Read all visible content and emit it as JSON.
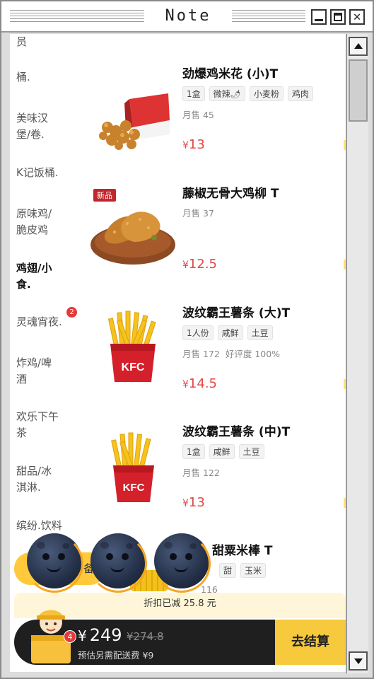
{
  "window": {
    "title": "Note"
  },
  "categories": [
    {
      "label": "员"
    },
    {
      "label": "桶."
    },
    {
      "label": "美味汉堡/卷."
    },
    {
      "label": "K记饭桶."
    },
    {
      "label": "原味鸡/脆皮鸡"
    },
    {
      "label": "鸡翅/小食."
    },
    {
      "label": "灵魂宵夜.",
      "badge": "2"
    },
    {
      "label": "炸鸡/啤酒"
    },
    {
      "label": "欢乐下午茶"
    },
    {
      "label": "甜品/冰淇淋."
    },
    {
      "label": "缤纷.饮料"
    }
  ],
  "products": [
    {
      "name": "劲爆鸡米花 (小)T",
      "tags": [
        "1盒",
        "微辣🌶",
        "小麦粉",
        "鸡肉"
      ],
      "sales": "月售 45",
      "rating": "",
      "price": "13"
    },
    {
      "name": "藤椒无骨大鸡柳 T",
      "tags": [],
      "sales": "月售 37",
      "rating": "",
      "price": "12.5",
      "new_label": "新品"
    },
    {
      "name": "波纹霸王薯条 (大)T",
      "tags": [
        "1人份",
        "咸鲜",
        "土豆"
      ],
      "sales": "月售 172",
      "rating": "好评度 100%",
      "price": "14.5"
    },
    {
      "name": "波纹霸王薯条 (中)T",
      "tags": [
        "1盒",
        "咸鲜",
        "土豆"
      ],
      "sales": "月售 122",
      "rating": "",
      "price": "13"
    }
  ],
  "peek": {
    "title": "甜粟米棒 T",
    "tags": [
      "甜",
      "玉米"
    ],
    "sales": "116",
    "pill_text": "备"
  },
  "currency": "¥",
  "cart": {
    "discount_text": "折扣已减 25.8 元",
    "total": "249",
    "original": "¥274.8",
    "delivery_fee": "预估另需配送费 ¥9",
    "count": "4",
    "checkout_label": "去结算"
  }
}
